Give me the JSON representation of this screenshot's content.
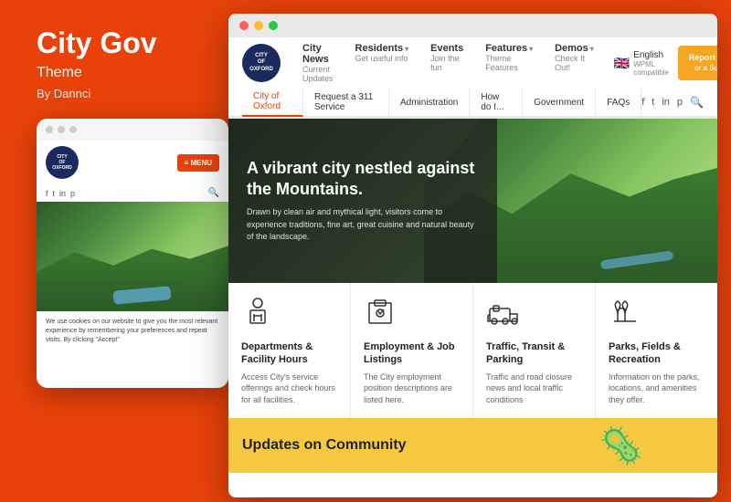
{
  "left": {
    "title": "City Gov",
    "subtitle": "Theme",
    "by": "By Dannci",
    "mobile": {
      "dots": [
        "dot1",
        "dot2",
        "dot3"
      ],
      "logo_text": "CITY OF OXFORD",
      "menu_label": "≡ MENU",
      "social_icons": [
        "f",
        "t",
        "in",
        "p"
      ],
      "cookie_text": "We use cookies on our website to give you the most relevant experience by remembering your preferences and repeat visits. By clicking \"Accept\""
    }
  },
  "browser": {
    "nav": {
      "logo_text": "CITY OF OXFORD",
      "items": [
        {
          "title": "City News",
          "sub": "Current Updates"
        },
        {
          "title": "Residents",
          "sub": "Get useful info",
          "has_arrow": true
        },
        {
          "title": "Events",
          "sub": "Join the fun"
        },
        {
          "title": "Features",
          "sub": "Theme Features",
          "has_arrow": true
        },
        {
          "title": "Demos",
          "sub": "Check It Out!",
          "has_arrow": true
        }
      ],
      "language": {
        "flag": "🇬🇧",
        "label": "English",
        "sub": "WPML compatible"
      },
      "report_btn": {
        "line1": "Report An Issue",
        "line2": "or a Suggestion"
      }
    },
    "secondary_nav": [
      "City of Oxford",
      "Request a 311 Service",
      "Administration",
      "How do I...",
      "Government",
      "FAQs"
    ],
    "secondary_nav_social": [
      "f",
      "t",
      "in",
      "p",
      "🔍"
    ],
    "hero": {
      "title": "A vibrant city nestled against the Mountains.",
      "desc": "Drawn by clean air and mythical light, visitors come to experience traditions, fine art, great cuisine and natural beauty of the landscape."
    },
    "services": [
      {
        "icon": "departments",
        "title": "Departments & Facility Hours",
        "desc": "Access City's service offerings and check hours for all facilities."
      },
      {
        "icon": "employment",
        "title": "Employment & Job Listings",
        "desc": "The City employment position descriptions are listed here."
      },
      {
        "icon": "traffic",
        "title": "Traffic, Transit & Parking",
        "desc": "Traffic and road closure news and local traffic conditions"
      },
      {
        "icon": "parks",
        "title": "Parks, Fields & Recreation",
        "desc": "Information on the parks, locations, and amenities they offer."
      }
    ],
    "bottom_strip": {
      "title": "Updates on Community"
    }
  }
}
